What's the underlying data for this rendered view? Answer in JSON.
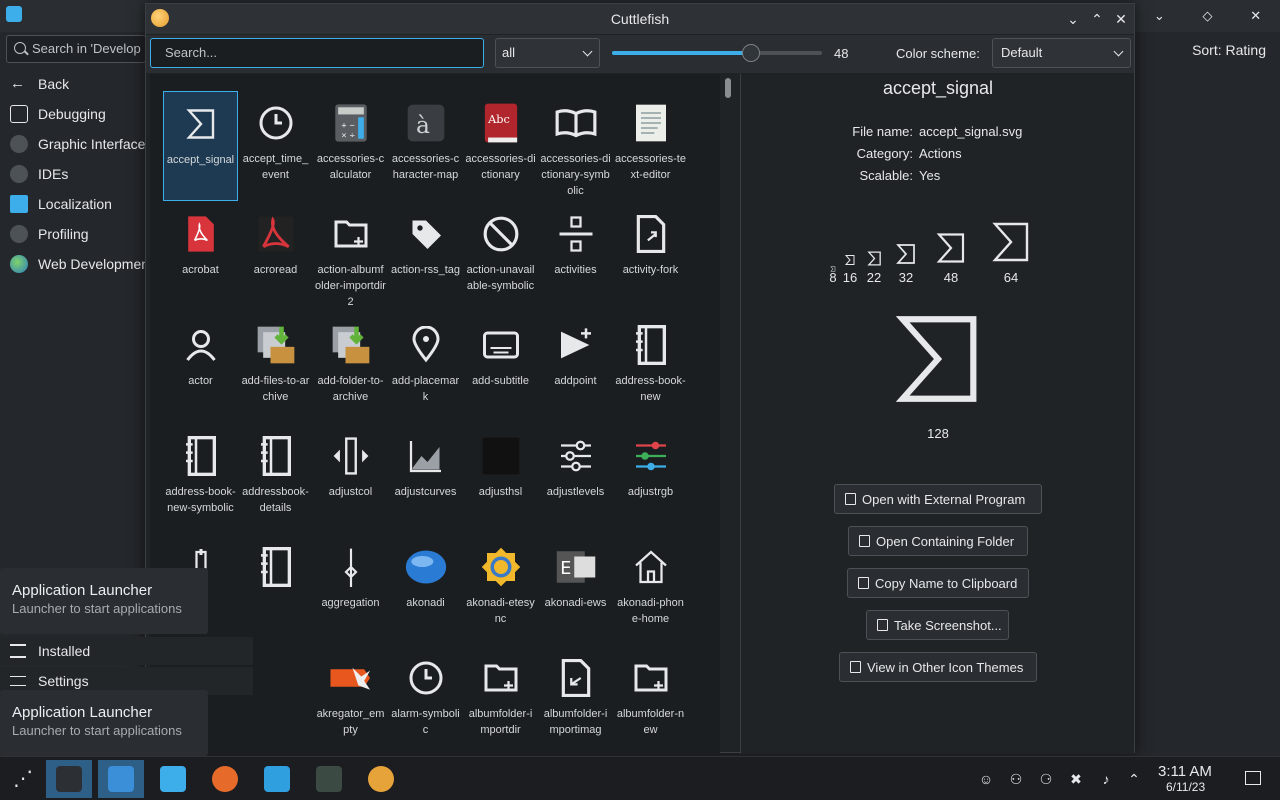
{
  "background_app": {
    "search_text": "Search in 'Develop",
    "nav": [
      {
        "label": "Back",
        "icon": "arrow-left-icon"
      },
      {
        "label": "Debugging",
        "icon": "debugging-icon"
      },
      {
        "label": "Graphic Interface",
        "icon": "dots-icon"
      },
      {
        "label": "IDEs",
        "icon": "dots-icon"
      },
      {
        "label": "Localization",
        "icon": "localization-icon"
      },
      {
        "label": "Profiling",
        "icon": "dots-icon"
      },
      {
        "label": "Web Development",
        "icon": "globe-icon"
      }
    ],
    "sort_label": "Sort: Rating"
  },
  "window": {
    "title": "Cuttlefish",
    "search_placeholder": "Search...",
    "category": "all",
    "icon_size": "48",
    "icon_size_fraction": 0.66,
    "color_scheme_label": "Color scheme:",
    "color_scheme": "Default"
  },
  "icons": [
    {
      "label": "accept_signal",
      "icon": "sigma-icon",
      "selected": true
    },
    {
      "label": "accept_time_event",
      "icon": "clock-icon"
    },
    {
      "label": "accessories-calculator",
      "icon": "calculator-icon"
    },
    {
      "label": "accessories-character-map",
      "icon": "character-map-icon"
    },
    {
      "label": "accessories-dictionary",
      "icon": "dictionary-icon"
    },
    {
      "label": "accessories-dictionary-symbolic",
      "icon": "book-open-icon"
    },
    {
      "label": "accessories-text-editor",
      "icon": "text-editor-icon"
    },
    {
      "label": "acrobat",
      "icon": "pdf-icon"
    },
    {
      "label": "acroread",
      "icon": "acroread-icon"
    },
    {
      "label": "action-albumfolder-importdir2",
      "icon": "folder-add-icon"
    },
    {
      "label": "action-rss_tag",
      "icon": "tag-icon"
    },
    {
      "label": "action-unavailable-symbolic",
      "icon": "unavailable-icon"
    },
    {
      "label": "activities",
      "icon": "activities-icon"
    },
    {
      "label": "activity-fork",
      "icon": "activity-fork-icon"
    },
    {
      "label": "actor",
      "icon": "user-icon"
    },
    {
      "label": "add-files-to-archive",
      "icon": "archive-add-files-icon"
    },
    {
      "label": "add-folder-to-archive",
      "icon": "archive-add-folder-icon"
    },
    {
      "label": "add-placemark",
      "icon": "placemark-icon"
    },
    {
      "label": "add-subtitle",
      "icon": "subtitle-icon"
    },
    {
      "label": "addpoint",
      "icon": "addpoint-icon"
    },
    {
      "label": "address-book-new",
      "icon": "address-book-icon"
    },
    {
      "label": "address-book-new-symbolic",
      "icon": "address-book-icon"
    },
    {
      "label": "addressbook-details",
      "icon": "address-book-icon"
    },
    {
      "label": "adjustcol",
      "icon": "adjust-columns-icon"
    },
    {
      "label": "adjustcurves",
      "icon": "curves-icon"
    },
    {
      "label": "adjusthsl",
      "icon": "hsl-icon"
    },
    {
      "label": "adjustlevels",
      "icon": "sliders-icon"
    },
    {
      "label": "adjustrgb",
      "icon": "rgb-sliders-icon"
    },
    {
      "label": "",
      "icon": "adjust-icon"
    },
    {
      "label": "",
      "icon": "address-book-icon"
    },
    {
      "label": "aggregation",
      "icon": "aggregation-icon"
    },
    {
      "label": "akonadi",
      "icon": "akonadi-icon"
    },
    {
      "label": "akonadi-etesync",
      "icon": "etesync-icon"
    },
    {
      "label": "akonadi-ews",
      "icon": "exchange-icon"
    },
    {
      "label": "akonadi-phone-home",
      "icon": "home-icon"
    },
    {
      "label": "",
      "icon": "blank-icon"
    },
    {
      "label": "",
      "icon": "blank-icon"
    },
    {
      "label": "akregator_empty",
      "icon": "akregator-icon"
    },
    {
      "label": "alarm-symbolic",
      "icon": "clock-icon"
    },
    {
      "label": "albumfolder-importdir",
      "icon": "folder-add-icon"
    },
    {
      "label": "albumfolder-importimag",
      "icon": "import-image-icon"
    },
    {
      "label": "albumfolder-new",
      "icon": "folder-add-icon"
    }
  ],
  "details": {
    "title": "accept_signal",
    "file_name_label": "File name:",
    "file_name": "accept_signal.svg",
    "category_label": "Category:",
    "category": "Actions",
    "scalable_label": "Scalable:",
    "scalable": "Yes",
    "sizes": [
      "8",
      "16",
      "22",
      "32",
      "48",
      "64",
      "128"
    ],
    "buttons": [
      "Open with External Program",
      "Open Containing Folder",
      "Copy Name to Clipboard",
      "Take Screenshot...",
      "View in Other Icon Themes"
    ]
  },
  "launcher": {
    "tooltip_title": "Application Launcher",
    "tooltip_sub": "Launcher to start applications",
    "menu": [
      {
        "label": "Installed",
        "icon": "list-icon"
      },
      {
        "label": "Settings",
        "icon": "settings-sliders-icon"
      }
    ]
  },
  "taskbar": {
    "apps": [
      "application-launcher-icon",
      "system-settings-icon",
      "discover-icon",
      "file-manager-icon",
      "firefox-icon",
      "folder-icon",
      "recycle-icon",
      "cuttlefish-icon"
    ],
    "tray": [
      "user-icon",
      "kdeconnect-icon",
      "network-icon",
      "microphone-muted-icon",
      "volume-icon",
      "chevron-up-icon"
    ],
    "time": "3:11 AM",
    "date": "6/11/23"
  },
  "colors": {
    "accent": "#3daee9",
    "window_bg": "#202326",
    "panel_bg": "#1b1e20"
  }
}
